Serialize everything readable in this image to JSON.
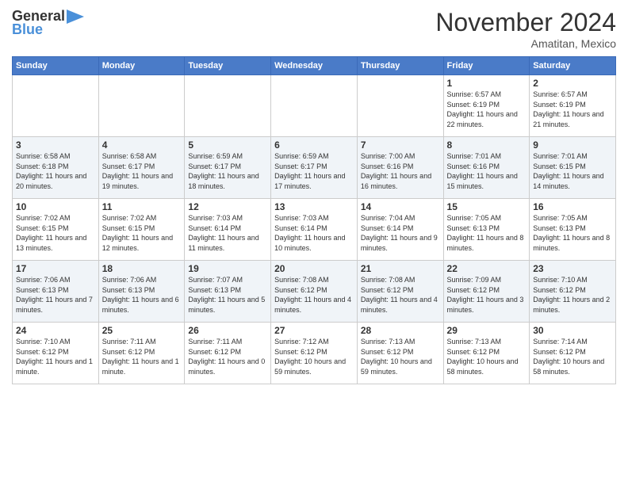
{
  "logo": {
    "general": "General",
    "blue": "Blue"
  },
  "header": {
    "month": "November 2024",
    "location": "Amatitan, Mexico"
  },
  "weekdays": [
    "Sunday",
    "Monday",
    "Tuesday",
    "Wednesday",
    "Thursday",
    "Friday",
    "Saturday"
  ],
  "weeks": [
    [
      {
        "day": "",
        "info": ""
      },
      {
        "day": "",
        "info": ""
      },
      {
        "day": "",
        "info": ""
      },
      {
        "day": "",
        "info": ""
      },
      {
        "day": "",
        "info": ""
      },
      {
        "day": "1",
        "info": "Sunrise: 6:57 AM\nSunset: 6:19 PM\nDaylight: 11 hours\nand 22 minutes."
      },
      {
        "day": "2",
        "info": "Sunrise: 6:57 AM\nSunset: 6:19 PM\nDaylight: 11 hours\nand 21 minutes."
      }
    ],
    [
      {
        "day": "3",
        "info": "Sunrise: 6:58 AM\nSunset: 6:18 PM\nDaylight: 11 hours\nand 20 minutes."
      },
      {
        "day": "4",
        "info": "Sunrise: 6:58 AM\nSunset: 6:17 PM\nDaylight: 11 hours\nand 19 minutes."
      },
      {
        "day": "5",
        "info": "Sunrise: 6:59 AM\nSunset: 6:17 PM\nDaylight: 11 hours\nand 18 minutes."
      },
      {
        "day": "6",
        "info": "Sunrise: 6:59 AM\nSunset: 6:17 PM\nDaylight: 11 hours\nand 17 minutes."
      },
      {
        "day": "7",
        "info": "Sunrise: 7:00 AM\nSunset: 6:16 PM\nDaylight: 11 hours\nand 16 minutes."
      },
      {
        "day": "8",
        "info": "Sunrise: 7:01 AM\nSunset: 6:16 PM\nDaylight: 11 hours\nand 15 minutes."
      },
      {
        "day": "9",
        "info": "Sunrise: 7:01 AM\nSunset: 6:15 PM\nDaylight: 11 hours\nand 14 minutes."
      }
    ],
    [
      {
        "day": "10",
        "info": "Sunrise: 7:02 AM\nSunset: 6:15 PM\nDaylight: 11 hours\nand 13 minutes."
      },
      {
        "day": "11",
        "info": "Sunrise: 7:02 AM\nSunset: 6:15 PM\nDaylight: 11 hours\nand 12 minutes."
      },
      {
        "day": "12",
        "info": "Sunrise: 7:03 AM\nSunset: 6:14 PM\nDaylight: 11 hours\nand 11 minutes."
      },
      {
        "day": "13",
        "info": "Sunrise: 7:03 AM\nSunset: 6:14 PM\nDaylight: 11 hours\nand 10 minutes."
      },
      {
        "day": "14",
        "info": "Sunrise: 7:04 AM\nSunset: 6:14 PM\nDaylight: 11 hours\nand 9 minutes."
      },
      {
        "day": "15",
        "info": "Sunrise: 7:05 AM\nSunset: 6:13 PM\nDaylight: 11 hours\nand 8 minutes."
      },
      {
        "day": "16",
        "info": "Sunrise: 7:05 AM\nSunset: 6:13 PM\nDaylight: 11 hours\nand 8 minutes."
      }
    ],
    [
      {
        "day": "17",
        "info": "Sunrise: 7:06 AM\nSunset: 6:13 PM\nDaylight: 11 hours\nand 7 minutes."
      },
      {
        "day": "18",
        "info": "Sunrise: 7:06 AM\nSunset: 6:13 PM\nDaylight: 11 hours\nand 6 minutes."
      },
      {
        "day": "19",
        "info": "Sunrise: 7:07 AM\nSunset: 6:13 PM\nDaylight: 11 hours\nand 5 minutes."
      },
      {
        "day": "20",
        "info": "Sunrise: 7:08 AM\nSunset: 6:12 PM\nDaylight: 11 hours\nand 4 minutes."
      },
      {
        "day": "21",
        "info": "Sunrise: 7:08 AM\nSunset: 6:12 PM\nDaylight: 11 hours\nand 4 minutes."
      },
      {
        "day": "22",
        "info": "Sunrise: 7:09 AM\nSunset: 6:12 PM\nDaylight: 11 hours\nand 3 minutes."
      },
      {
        "day": "23",
        "info": "Sunrise: 7:10 AM\nSunset: 6:12 PM\nDaylight: 11 hours\nand 2 minutes."
      }
    ],
    [
      {
        "day": "24",
        "info": "Sunrise: 7:10 AM\nSunset: 6:12 PM\nDaylight: 11 hours\nand 1 minute."
      },
      {
        "day": "25",
        "info": "Sunrise: 7:11 AM\nSunset: 6:12 PM\nDaylight: 11 hours\nand 1 minute."
      },
      {
        "day": "26",
        "info": "Sunrise: 7:11 AM\nSunset: 6:12 PM\nDaylight: 11 hours\nand 0 minutes."
      },
      {
        "day": "27",
        "info": "Sunrise: 7:12 AM\nSunset: 6:12 PM\nDaylight: 10 hours\nand 59 minutes."
      },
      {
        "day": "28",
        "info": "Sunrise: 7:13 AM\nSunset: 6:12 PM\nDaylight: 10 hours\nand 59 minutes."
      },
      {
        "day": "29",
        "info": "Sunrise: 7:13 AM\nSunset: 6:12 PM\nDaylight: 10 hours\nand 58 minutes."
      },
      {
        "day": "30",
        "info": "Sunrise: 7:14 AM\nSunset: 6:12 PM\nDaylight: 10 hours\nand 58 minutes."
      }
    ]
  ]
}
